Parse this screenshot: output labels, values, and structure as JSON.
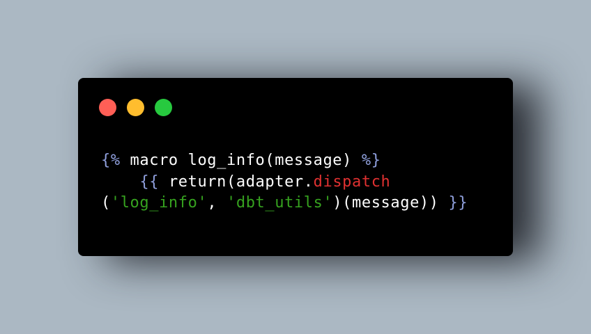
{
  "colors": {
    "background": "#abb8c3",
    "window": "#000000",
    "dot_close": "#ff5f56",
    "dot_minimize": "#ffbd2e",
    "dot_maximize": "#27c93f",
    "delimiter": "#8f9fdc",
    "text": "#ffffff",
    "function": "#e03131",
    "string": "#36a21f"
  },
  "window_controls": [
    "close",
    "minimize",
    "maximize"
  ],
  "code": {
    "lines": [
      [
        {
          "type": "delim",
          "text": "{%"
        },
        {
          "type": "text",
          "text": " macro log_info(message) "
        },
        {
          "type": "delim",
          "text": "%}"
        }
      ],
      [
        {
          "type": "text",
          "text": "    "
        },
        {
          "type": "delim",
          "text": "{{"
        },
        {
          "type": "text",
          "text": " return(adapter."
        },
        {
          "type": "func",
          "text": "dispatch"
        }
      ],
      [
        {
          "type": "text",
          "text": "("
        },
        {
          "type": "str",
          "text": "'log_info'"
        },
        {
          "type": "text",
          "text": ", "
        },
        {
          "type": "str",
          "text": "'dbt_utils'"
        },
        {
          "type": "text",
          "text": ")(message)) "
        },
        {
          "type": "delim",
          "text": "}}"
        }
      ]
    ]
  }
}
